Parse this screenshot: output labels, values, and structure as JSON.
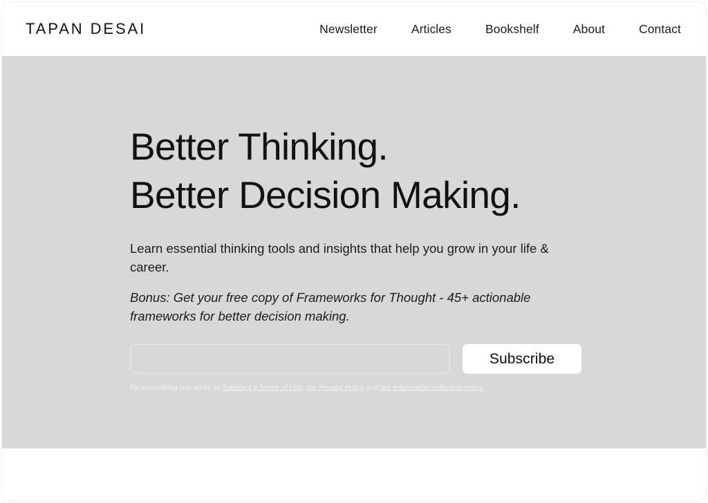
{
  "header": {
    "brand": "TAPAN DESAI",
    "nav": [
      {
        "label": "Newsletter",
        "name": "nav-item-newsletter"
      },
      {
        "label": "Articles",
        "name": "nav-item-articles"
      },
      {
        "label": "Bookshelf",
        "name": "nav-item-bookshelf"
      },
      {
        "label": "About",
        "name": "nav-item-about"
      },
      {
        "label": "Contact",
        "name": "nav-item-contact"
      }
    ]
  },
  "hero": {
    "headline_line1": "Better Thinking.",
    "headline_line2": "Better Decision Making.",
    "subcopy": "Learn essential thinking tools and insights that help you grow in your life & career.",
    "bonus": "Bonus: Get your free copy of Frameworks for Thought - 45+ actionable frameworks for better decision making.",
    "background_color": "#d8d8d9",
    "text_color": "#111111"
  },
  "subscribe": {
    "email_value": "",
    "email_placeholder": "",
    "button_label": "Subscribe",
    "button_background": "#ffffff",
    "button_text_color": "#0c0c0c"
  },
  "fineprint": {
    "prefix": "By subscribing you agree to ",
    "link_terms": "Substack's Terms of Use",
    "separator1": ", ",
    "link_privacy": "our Privacy Policy",
    "separator2": " and ",
    "link_notice": "our Information collection notice",
    "text_color": "#f2f2f2"
  }
}
